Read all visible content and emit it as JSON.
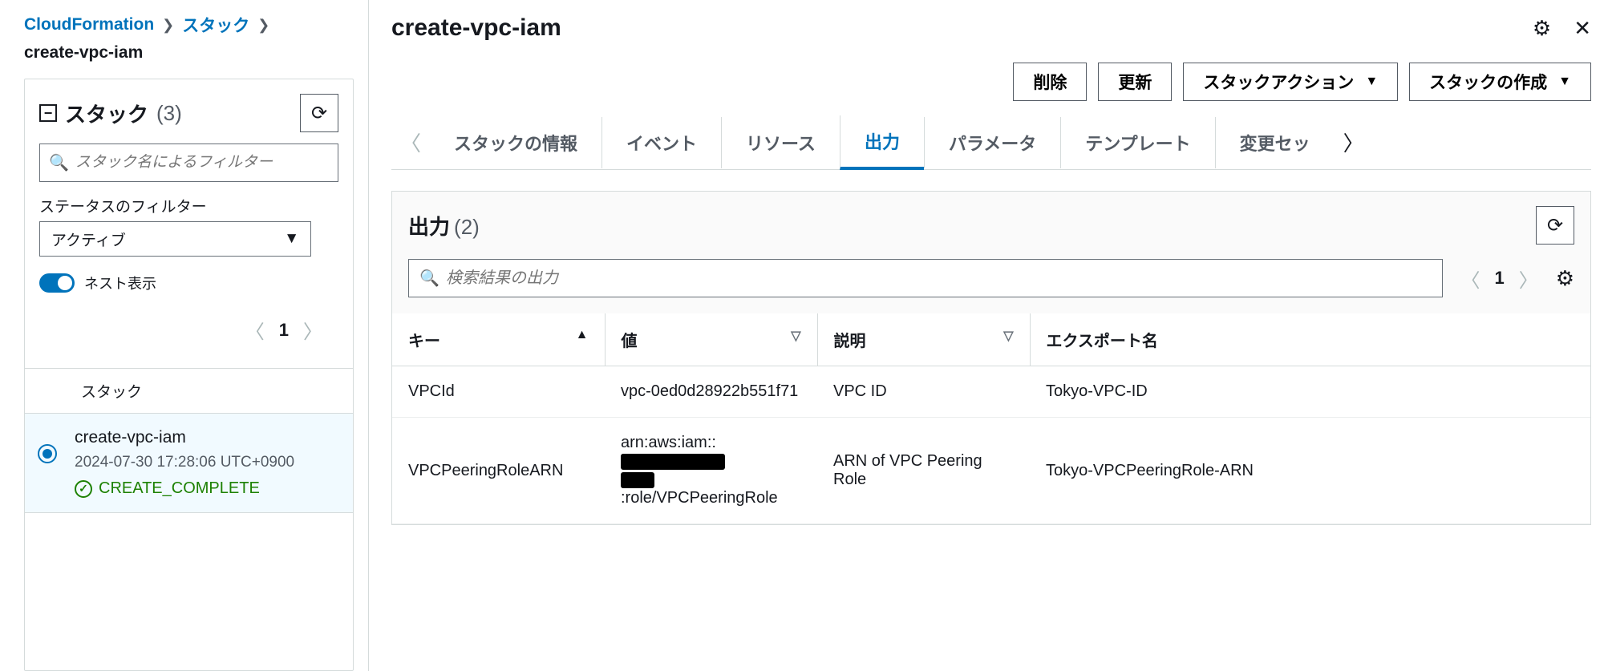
{
  "breadcrumb": {
    "root": "CloudFormation",
    "stacks": "スタック",
    "current": "create-vpc-iam"
  },
  "sidebar": {
    "title": "スタック",
    "count": "(3)",
    "search_placeholder": "スタック名によるフィルター",
    "status_filter_label": "ステータスのフィルター",
    "status_filter_value": "アクティブ",
    "nested_toggle_label": "ネスト表示",
    "pager_page": "1",
    "list_header": "スタック",
    "items": [
      {
        "name": "create-vpc-iam",
        "date": "2024-07-30 17:28:06 UTC+0900",
        "status": "CREATE_COMPLETE",
        "selected": true
      }
    ]
  },
  "main": {
    "title": "create-vpc-iam",
    "buttons": {
      "delete": "削除",
      "update": "更新",
      "stack_actions": "スタックアクション",
      "create_stack": "スタックの作成"
    },
    "tabs": [
      "スタックの情報",
      "イベント",
      "リソース",
      "出力",
      "パラメータ",
      "テンプレート",
      "変更セッ"
    ],
    "active_tab_index": 3
  },
  "outputs": {
    "title": "出力",
    "count": "(2)",
    "search_placeholder": "検索結果の出力",
    "pager_page": "1",
    "columns": {
      "key": "キー",
      "value": "値",
      "description": "説明",
      "export_name": "エクスポート名"
    },
    "rows": [
      {
        "key": "VPCId",
        "value": "vpc-0ed0d28922b551f71",
        "description": "VPC ID",
        "export_name": "Tokyo-VPC-ID"
      },
      {
        "key": "VPCPeeringRoleARN",
        "value_prefix": "arn:aws:iam::",
        "value_mid": ":role/VPCPeeringRole",
        "description": "ARN of VPC Peering Role",
        "export_name": "Tokyo-VPCPeeringRole-ARN"
      }
    ]
  }
}
